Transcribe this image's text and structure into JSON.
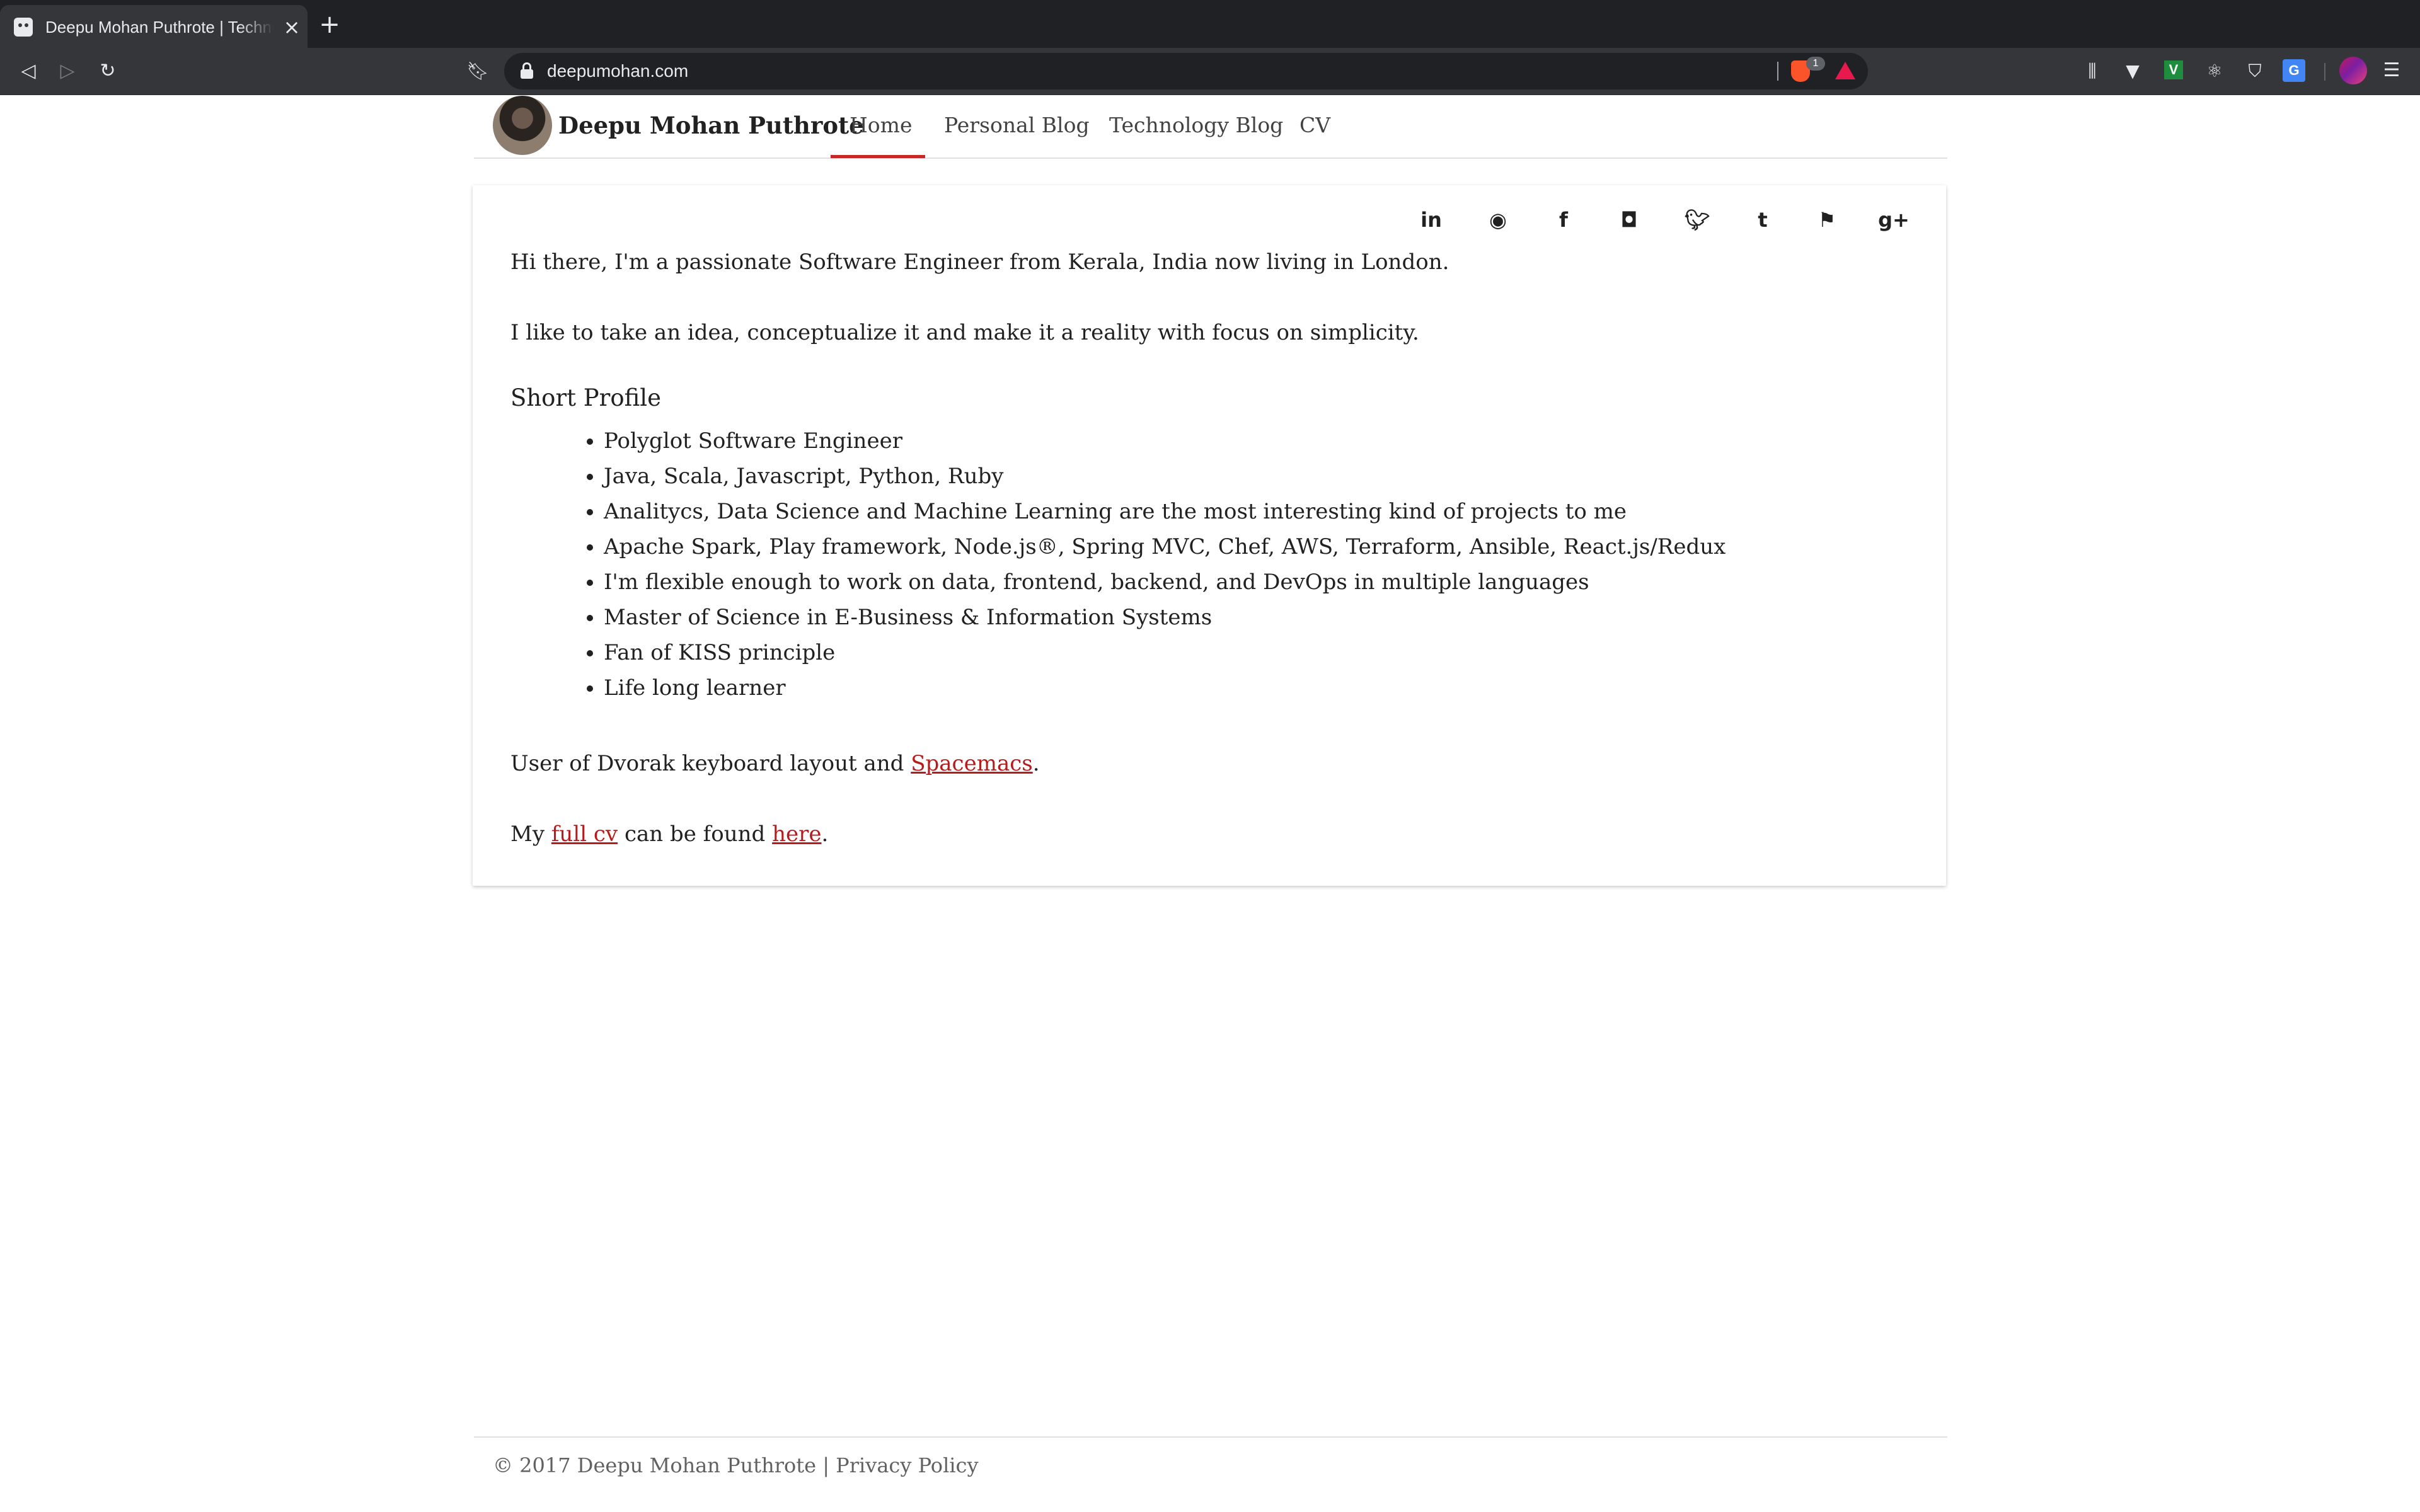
{
  "browser": {
    "tab_title": "Deepu Mohan Puthrote | Technology Blog",
    "url": "deepumohan.com",
    "shield_count": "1"
  },
  "site": {
    "title": "Deepu Mohan Puthrote",
    "nav": [
      "Home",
      "Personal Blog",
      "Technology Blog",
      "CV"
    ],
    "active_nav": "Home"
  },
  "social_links": [
    "linkedin",
    "github",
    "facebook",
    "instagram",
    "twitter",
    "tumblr",
    "foursquare",
    "google-plus"
  ],
  "content": {
    "intro": "Hi there, I'm a passionate Software Engineer from Kerala, India now living in London.",
    "idea": "I like to take an idea, conceptualize it and make it a reality with focus on simplicity.",
    "profile_heading": "Short Profile",
    "profile_items": [
      "Polyglot Software Engineer",
      "Java, Scala, Javascript, Python, Ruby",
      "Analitycs, Data Science and Machine Learning are the most interesting kind of projects to me",
      "Apache Spark, Play framework, Node.js®, Spring MVC, Chef, AWS, Terraform, Ansible, React.js/Redux",
      "I'm flexible enough to work on data, frontend, backend, and DevOps in multiple languages",
      "Master of Science in E-Business & Information Systems",
      "Fan of KISS principle",
      "Life long learner"
    ],
    "dvorak_prefix": "User of Dvorak keyboard layout and ",
    "spacemacs_link": "Spacemacs",
    "dvorak_suffix": ".",
    "cv_prefix": "My ",
    "cv_link": "full cv",
    "cv_middle": " can be found ",
    "here_link": "here",
    "cv_suffix": "."
  },
  "footer": {
    "text": "© 2017 Deepu Mohan Puthrote | Privacy Policy"
  },
  "colors": {
    "link": "#b71c1c",
    "active_underline": "#c62828",
    "chrome_dark": "#202124",
    "chrome_toolbar": "#35363a"
  }
}
